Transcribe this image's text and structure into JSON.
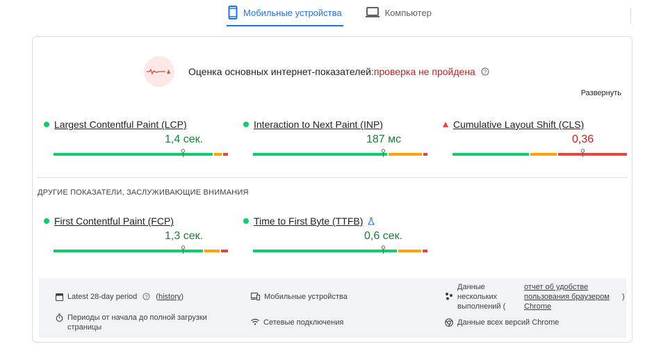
{
  "tabs": [
    {
      "label": "Мобильные устройства",
      "icon": "smartphone-icon",
      "active": true
    },
    {
      "label": "Компьютер",
      "icon": "desktop-icon",
      "active": false
    }
  ],
  "assessment": {
    "title": "Оценка основных интернет-показателей:",
    "status": "проверка не пройдена",
    "status_color": "#c5221f",
    "expand_label": "Развернуть"
  },
  "core_metrics": [
    {
      "label": "Largest Contentful Paint (LCP)",
      "value": "1,4 сек.",
      "rating": "good"
    },
    {
      "label": "Interaction to Next Paint (INP)",
      "value": "187 мс",
      "rating": "good"
    },
    {
      "label": "Cumulative Layout Shift (CLS)",
      "value": "0,36",
      "rating": "poor"
    }
  ],
  "other_title": "ДРУГИЕ ПОКАЗАТЕЛИ, ЗАСЛУЖИВАЮЩИЕ ВНИМАНИЯ",
  "other_metrics": [
    {
      "label": "First Contentful Paint (FCP)",
      "value": "1,3 сек.",
      "rating": "good"
    },
    {
      "label": "Time to First Byte (TTFB)",
      "value": "0,6 сек.",
      "rating": "good",
      "experimental_icon": "flask-icon"
    }
  ],
  "footer": {
    "period": "Latest 28-day period",
    "history_link": "history",
    "history_open": "(",
    "history_close": ")",
    "devices": "Мобильные устройства",
    "multi_runs": [
      "Данные",
      "нескольких",
      "выполнений ("
    ],
    "report_link": [
      "отчет об удобстве",
      "пользования браузером",
      "Chrome"
    ],
    "report_close": ")",
    "durations": [
      "Периоды от начала до полной загрузки",
      "страницы"
    ],
    "network": "Сетевые подключения",
    "versions": "Данные всех версий Chrome"
  },
  "colors": {
    "good": "#0cce6b",
    "average": "#ffa400",
    "poor": "#e8453c",
    "accent": "#1a73e8"
  }
}
